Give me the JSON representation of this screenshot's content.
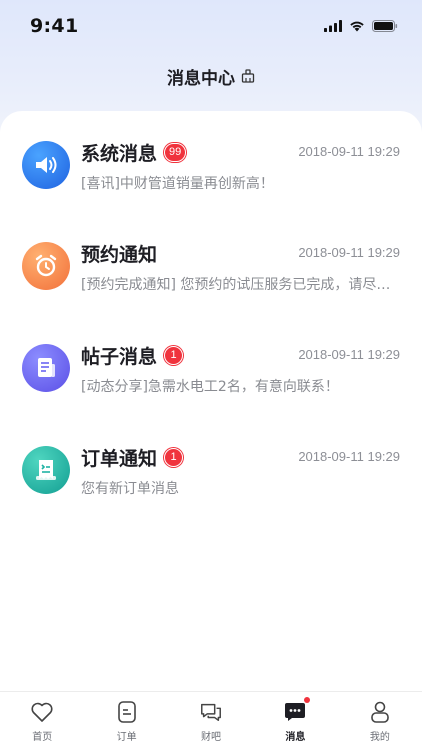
{
  "status_bar": {
    "time": "9:41"
  },
  "header": {
    "title": "消息中心"
  },
  "messages": [
    {
      "title": "系统消息",
      "badge": "99",
      "time": "2018-09-11 19:29",
      "preview": "[喜讯]中财管道销量再创新高！",
      "icon": "speaker-icon",
      "color": "#2f7cf0"
    },
    {
      "title": "预约通知",
      "badge": "",
      "time": "2018-09-11 19:29",
      "preview": "[预约完成通知] 您预约的试压服务已完成，请尽快确认",
      "icon": "alarm-clock-icon",
      "color": "#f5813f"
    },
    {
      "title": "帖子消息",
      "badge": "1",
      "time": "2018-09-11 19:29",
      "preview": "[动态分享]急需水电工2名，有意向联系！",
      "icon": "document-icon",
      "color": "#6a66f2"
    },
    {
      "title": "订单通知",
      "badge": "1",
      "time": "2018-09-11 19:29",
      "preview": "您有新订单消息",
      "icon": "receipt-icon",
      "color": "#1fb2a3"
    }
  ],
  "tabbar": [
    {
      "label": "首页",
      "icon": "heart-icon",
      "active": false
    },
    {
      "label": "订单",
      "icon": "order-icon",
      "active": false
    },
    {
      "label": "财吧",
      "icon": "chat-icon",
      "active": false
    },
    {
      "label": "消息",
      "icon": "message-icon",
      "active": true
    },
    {
      "label": "我的",
      "icon": "profile-icon",
      "active": false
    }
  ]
}
